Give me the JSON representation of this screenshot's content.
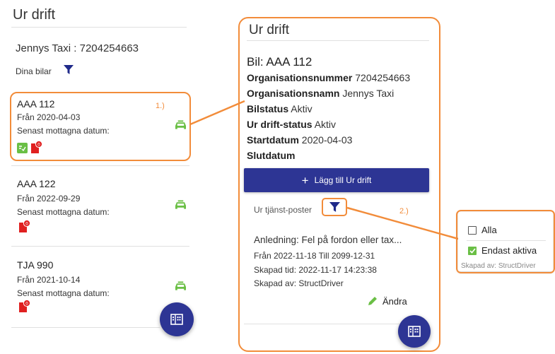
{
  "left": {
    "title": "Ur drift",
    "company": "Jennys Taxi : 7204254663",
    "my_cars_label": "Dina bilar",
    "cars": [
      {
        "plate": "AAA 112",
        "from": "Från 2020-04-03",
        "received": "Senast mottagna datum:",
        "badge": "0"
      },
      {
        "plate": "AAA 122",
        "from": "Från 2022-09-29",
        "received": "Senast mottagna datum:",
        "badge": "0"
      },
      {
        "plate": "TJA 990",
        "from": "Från 2021-10-14",
        "received": "Senast mottagna datum:",
        "badge": "0"
      }
    ]
  },
  "annotations": {
    "one": "1.)",
    "two": "2.)"
  },
  "detail": {
    "title": "Ur drift",
    "car_heading": "Bil: AAA 112",
    "fields": [
      {
        "label": "Organisationsnummer",
        "value": "7204254663"
      },
      {
        "label": "Organisationsnamn",
        "value": "Jennys Taxi"
      },
      {
        "label": "Bilstatus",
        "value": "Aktiv"
      },
      {
        "label": "Ur drift-status",
        "value": "Aktiv"
      },
      {
        "label": "Startdatum",
        "value": "2020-04-03"
      },
      {
        "label": "Slutdatum",
        "value": ""
      }
    ],
    "add_button": "Lägg till Ur drift",
    "posts_label": "Ur tjänst-poster",
    "record": {
      "reason": "Anledning: Fel på fordon eller tax...",
      "period": "Från 2022-11-18 Till 2099-12-31",
      "created": "Skapad tid: 2022-11-17 14:23:38",
      "created_by": "Skapad av: StructDriver",
      "edit_label": "Ändra"
    }
  },
  "filter_popup": {
    "options": [
      {
        "label": "Alla",
        "checked": false
      },
      {
        "label": "Endast aktiva",
        "checked": true
      }
    ],
    "partial_text": "Skapad av: StructDriver"
  },
  "colors": {
    "accent": "#2d3594",
    "annotation": "#f28c3a",
    "taxi_green": "#6abf45",
    "alert_red": "#e02020"
  }
}
